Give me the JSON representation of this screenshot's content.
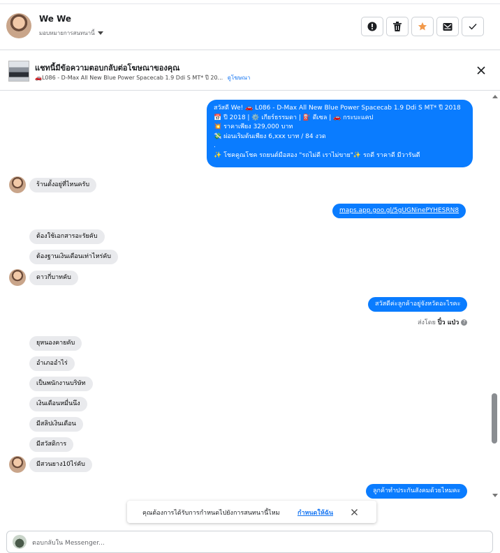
{
  "header": {
    "user_name": "We We",
    "assign_label": "มอบหมายการสนทนานี้"
  },
  "actions": [
    {
      "name": "spam-button",
      "icon": "alert-circle-icon"
    },
    {
      "name": "delete-button",
      "icon": "trash-icon"
    },
    {
      "name": "star-button",
      "icon": "star-icon",
      "color": "#f2994a"
    },
    {
      "name": "mark-unread-button",
      "icon": "envelope-icon"
    },
    {
      "name": "mark-done-button",
      "icon": "check-icon"
    }
  ],
  "ad": {
    "title": "แชทนี้มีข้อความตอบกลับต่อโฆษณาของคุณ",
    "subtitle": "🚗L086 - D-Max All New Blue Power Spacecab 1.9 Ddi S MT* ปี 20...",
    "link": "ดูโฆษณา"
  },
  "messages": {
    "intro_lines": [
      "สวัสดี We! 🚗 L086 - D-Max All New Blue Power Spacecab 1.9 Ddi S MT* ปี 2018",
      "📅 ปี 2018 | ⚙️ เกียร์ธรรมดา | ⛽ ดีเซล | 🚗 กระบะแคป",
      "💥 ราคาเพียง 329,000 บาท",
      "💸 ผ่อนเริ่มต้นเพียง 6,xxx บาท / 84 งวด",
      ".",
      "✨ โชคคูณโชค รถยนต์มือสอง \"รถไม่ดี เราไม่ขาย\"✨ รถดี ราคาดี มีวารันตี"
    ],
    "m1": "ร้านตั้งอยู่ที่ไหนครับ",
    "link": "maps.app.goo.gl/5gUGNinePYHESRN8",
    "m2": "ต้องใช้เอกสารอะรัยคับ",
    "m3": "ต้องฐานเงินเดือนเท่าไหร่คับ",
    "m4": "ดาวกี่บาทคับ",
    "m5": "สวัสดีค่ะลูกค้าอยู่จังหวัดอะไรคะ",
    "sent_by_prefix": "ส่งโดย",
    "sent_by_name": "ปิ๋ว แป่ว",
    "m6": "ยุหนองคายคับ",
    "m7": "อำเภออำไร่",
    "m8": "เป็นพนักงานบริษัท",
    "m9": "เงินเดือนหมื่นนึง",
    "m10": "มีสลิปเงินเดือน",
    "m11": "มีสวัสดิการ",
    "m12": "มีสวนยาง10ไร่คับ",
    "m13": "ลูกค้าทำประกันสังคมด้วยไหมคะ"
  },
  "toast": {
    "text": "คุณต้องการได้รับการกำหนดไปยังการสนทนานี้ไหม",
    "link": "กำหนดให้ฉัน"
  },
  "reply": {
    "placeholder": "ตอบกลับใน Messenger..."
  },
  "colors": {
    "outgoing": "#0a7cff",
    "incoming": "#e9eaed",
    "link": "#1877f2"
  }
}
